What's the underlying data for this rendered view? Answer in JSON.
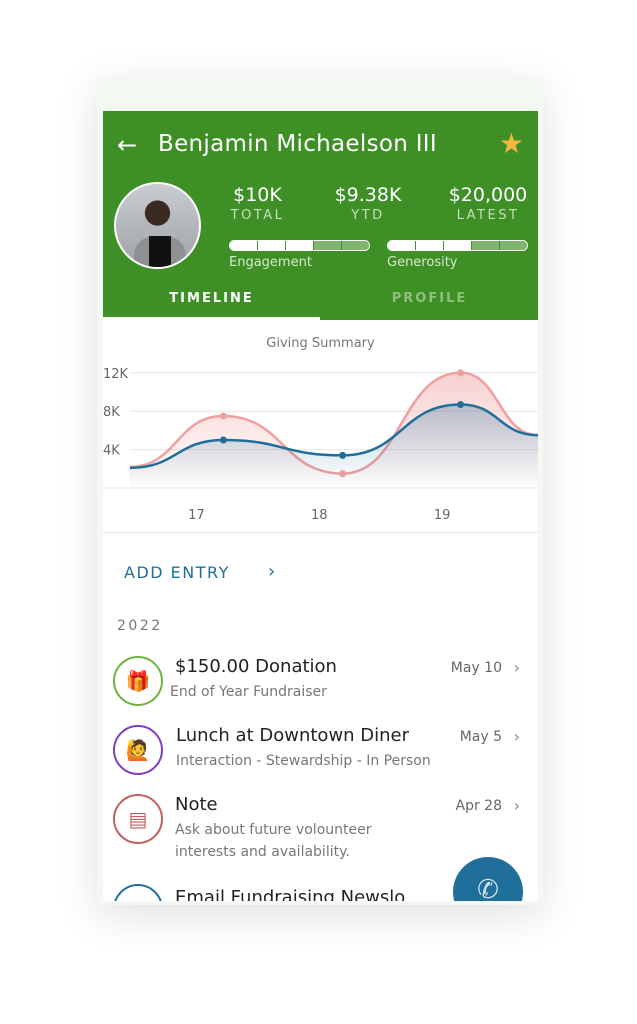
{
  "header": {
    "title": "Benjamin Michaelson III",
    "back_icon": "arrow-left-icon",
    "star_icon": "star-icon",
    "star_color": "#f4b63f",
    "brand_color": "#3f8f27"
  },
  "stats": [
    {
      "value": "$10K",
      "label": "TOTAL"
    },
    {
      "value": "$9.38K",
      "label": "YTD"
    },
    {
      "value": "$20,000",
      "label": "LATEST"
    }
  ],
  "meters": [
    {
      "label": "Engagement",
      "filled": 3,
      "segments": 5
    },
    {
      "label": "Generosity",
      "filled": 3,
      "segments": 5
    }
  ],
  "tabs": [
    {
      "label": "TIMELINE",
      "active": true
    },
    {
      "label": "PROFILE",
      "active": false
    }
  ],
  "chart_data": {
    "type": "line",
    "title": "Giving Summary",
    "yticks": [
      "4K",
      "8K",
      "12K"
    ],
    "ylim": [
      0,
      12000
    ],
    "xticks": [
      "17",
      "18",
      "19"
    ],
    "xlim": [
      16.46,
      19.78
    ],
    "series": [
      {
        "color": "#f0a0a0",
        "fill": true,
        "x": [
          16.46,
          17.22,
          18.19,
          19.15,
          19.78
        ],
        "y": [
          2200,
          7500,
          1500,
          12000,
          5500
        ]
      },
      {
        "color": "#1f6f9a",
        "fill": true,
        "x": [
          16.46,
          17.22,
          18.19,
          19.15,
          19.78
        ],
        "y": [
          2100,
          5000,
          3400,
          8700,
          5500
        ]
      }
    ]
  },
  "add_entry": "ADD ENTRY",
  "year": "2022",
  "items": [
    {
      "title": "$150.00 Donation",
      "sub": "End of Year Fundraiser",
      "date": "May 10",
      "icon": "gift-card-icon",
      "color": "#6cb33f"
    },
    {
      "title": "Lunch at Downtown Diner",
      "sub": "Interaction - Stewardship - In Person",
      "date": "May 5",
      "icon": "person-waving-icon",
      "color": "#7b3fc4"
    },
    {
      "title": "Note",
      "sub": "Ask about future volounteer interests and availability.",
      "date": "Apr 28",
      "icon": "note-icon",
      "color": "#c06060"
    },
    {
      "title": "Email Fundraising Newslo",
      "sub": "",
      "date": "",
      "icon": "email-icon",
      "color": "#1f6f9a"
    }
  ],
  "fab_icon": "phone-icon"
}
